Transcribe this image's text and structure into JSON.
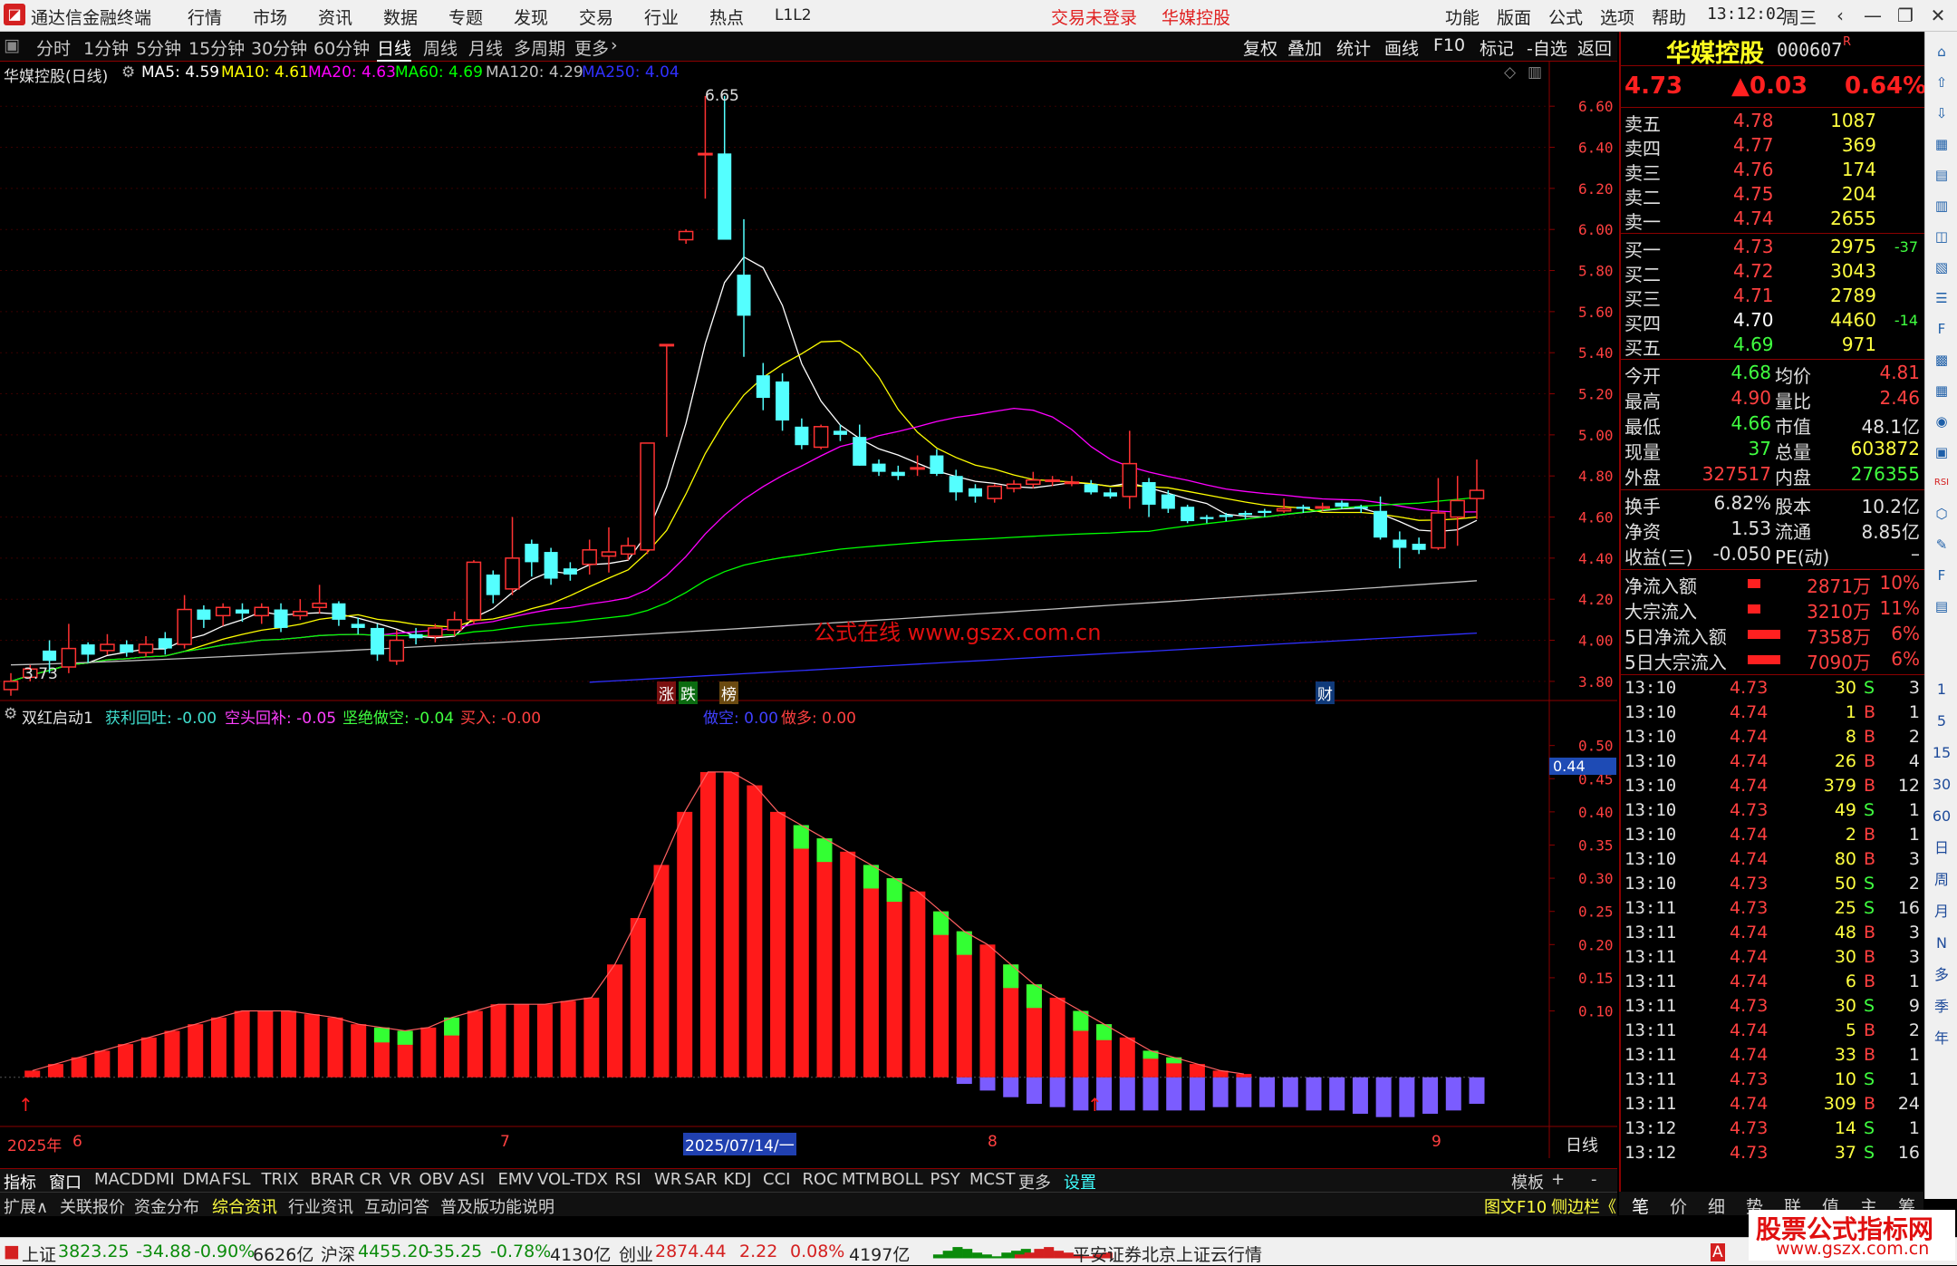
{
  "title_bar": {
    "app_title": "通达信金融终端",
    "menu": [
      "行情",
      "市场",
      "资讯",
      "数据",
      "专题",
      "发现",
      "交易",
      "行业",
      "热点",
      "L1L2"
    ],
    "login_status": "交易未登录",
    "stock_name": "华媒控股",
    "right_menu": [
      "功能",
      "版面",
      "公式",
      "选项",
      "帮助"
    ],
    "time": "13:12:02",
    "weekday": "周三"
  },
  "period_bar": {
    "periods": [
      "分时",
      "1分钟",
      "5分钟",
      "15分钟",
      "30分钟",
      "60分钟",
      "日线",
      "周线",
      "月线",
      "多周期",
      "更多"
    ],
    "active": "日线",
    "tools": [
      "复权",
      "叠加",
      "统计",
      "画线",
      "F10",
      "标记",
      "-自选",
      "返回"
    ]
  },
  "main_chart": {
    "stock_label": "华媒控股(日线)",
    "ma_labels": [
      {
        "text": "MA5: 4.59",
        "color": "#ffffff"
      },
      {
        "text": "MA10: 4.61",
        "color": "#ffff00"
      },
      {
        "text": "MA20: 4.63",
        "color": "#ff00ff"
      },
      {
        "text": "MA60: 4.69",
        "color": "#00ff00"
      },
      {
        "text": "MA120: 4.29",
        "color": "#c0c0c0"
      },
      {
        "text": "MA250: 4.04",
        "color": "#3030ff"
      }
    ],
    "high_label": "6.65",
    "low_label": "3.73",
    "markers": [
      "涨",
      "跌",
      "榜",
      "财"
    ],
    "watermark": "公式在线  www.gszx.com.cn"
  },
  "indicator": {
    "name": "双红启动1",
    "values": [
      {
        "text": "获利回吐: -0.00",
        "color": "#40e0d0"
      },
      {
        "text": "空头回补: -0.05",
        "color": "#ff40ff"
      },
      {
        "text": "坚绝做空: -0.04",
        "color": "#40ff40"
      },
      {
        "text": "买入: -0.00",
        "color": "#ff4040"
      },
      {
        "text": "做空: 0.00",
        "color": "#4040ff"
      },
      {
        "text": "做多: 0.00",
        "color": "#ff4040"
      }
    ],
    "current_value": "0.44"
  },
  "chart_data": [
    {
      "type": "candlestick",
      "title": "华媒控股(日线)",
      "y_ticks": [
        "6.60",
        "6.40",
        "6.20",
        "6.00",
        "5.80",
        "5.60",
        "5.40",
        "5.20",
        "5.00",
        "4.80",
        "4.60",
        "4.40",
        "4.20",
        "4.00",
        "3.80"
      ],
      "ylim": [
        3.72,
        6.72
      ],
      "candles": [
        {
          "o": 3.76,
          "c": 3.8,
          "h": 3.84,
          "l": 3.73
        },
        {
          "o": 3.82,
          "c": 3.86,
          "h": 3.88,
          "l": 3.8
        },
        {
          "o": 3.95,
          "c": 3.9,
          "h": 4.0,
          "l": 3.84
        },
        {
          "o": 3.87,
          "c": 3.96,
          "h": 4.08,
          "l": 3.84
        },
        {
          "o": 3.98,
          "c": 3.93,
          "h": 3.99,
          "l": 3.89
        },
        {
          "o": 3.95,
          "c": 3.98,
          "h": 4.03,
          "l": 3.93
        },
        {
          "o": 3.98,
          "c": 3.94,
          "h": 4.0,
          "l": 3.92
        },
        {
          "o": 3.94,
          "c": 3.98,
          "h": 4.02,
          "l": 3.92
        },
        {
          "o": 4.01,
          "c": 3.96,
          "h": 4.04,
          "l": 3.93
        },
        {
          "o": 3.98,
          "c": 4.15,
          "h": 4.22,
          "l": 3.96
        },
        {
          "o": 4.15,
          "c": 4.1,
          "h": 4.17,
          "l": 4.06
        },
        {
          "o": 4.12,
          "c": 4.16,
          "h": 4.18,
          "l": 4.07
        },
        {
          "o": 4.15,
          "c": 4.13,
          "h": 4.18,
          "l": 4.09
        },
        {
          "o": 4.12,
          "c": 4.16,
          "h": 4.18,
          "l": 4.08
        },
        {
          "o": 4.15,
          "c": 4.06,
          "h": 4.18,
          "l": 4.04
        },
        {
          "o": 4.12,
          "c": 4.14,
          "h": 4.2,
          "l": 4.1
        },
        {
          "o": 4.16,
          "c": 4.18,
          "h": 4.27,
          "l": 4.13
        },
        {
          "o": 4.18,
          "c": 4.1,
          "h": 4.19,
          "l": 4.07
        },
        {
          "o": 4.08,
          "c": 4.06,
          "h": 4.11,
          "l": 4.03
        },
        {
          "o": 4.06,
          "c": 3.93,
          "h": 4.08,
          "l": 3.9
        },
        {
          "o": 3.9,
          "c": 4.0,
          "h": 4.05,
          "l": 3.88
        },
        {
          "o": 4.03,
          "c": 4.01,
          "h": 4.06,
          "l": 3.98
        },
        {
          "o": 4.02,
          "c": 4.06,
          "h": 4.08,
          "l": 3.99
        },
        {
          "o": 4.05,
          "c": 4.1,
          "h": 4.14,
          "l": 4.02
        },
        {
          "o": 4.1,
          "c": 4.38,
          "h": 4.39,
          "l": 4.08
        },
        {
          "o": 4.32,
          "c": 4.22,
          "h": 4.34,
          "l": 4.18
        },
        {
          "o": 4.25,
          "c": 4.4,
          "h": 4.6,
          "l": 4.22
        },
        {
          "o": 4.47,
          "c": 4.38,
          "h": 4.49,
          "l": 4.31
        },
        {
          "o": 4.43,
          "c": 4.3,
          "h": 4.45,
          "l": 4.27
        },
        {
          "o": 4.35,
          "c": 4.32,
          "h": 4.38,
          "l": 4.29
        },
        {
          "o": 4.37,
          "c": 4.44,
          "h": 4.49,
          "l": 4.32
        },
        {
          "o": 4.41,
          "c": 4.43,
          "h": 4.55,
          "l": 4.33
        },
        {
          "o": 4.42,
          "c": 4.46,
          "h": 4.5,
          "l": 4.39
        },
        {
          "o": 4.44,
          "c": 4.96,
          "h": 4.96,
          "l": 4.42
        },
        {
          "o": 5.44,
          "c": 5.44,
          "h": 5.44,
          "l": 4.99
        },
        {
          "o": 5.95,
          "c": 5.99,
          "h": 6.0,
          "l": 5.93
        },
        {
          "o": 6.37,
          "c": 6.37,
          "h": 6.65,
          "l": 6.15
        },
        {
          "o": 6.37,
          "c": 5.95,
          "h": 6.65,
          "l": 5.95
        },
        {
          "o": 5.78,
          "c": 5.58,
          "h": 6.05,
          "l": 5.38
        },
        {
          "o": 5.29,
          "c": 5.18,
          "h": 5.35,
          "l": 5.12
        },
        {
          "o": 5.26,
          "c": 5.07,
          "h": 5.3,
          "l": 5.02
        },
        {
          "o": 5.04,
          "c": 4.95,
          "h": 5.08,
          "l": 4.93
        },
        {
          "o": 4.94,
          "c": 5.04,
          "h": 5.05,
          "l": 4.93
        },
        {
          "o": 5.02,
          "c": 5.0,
          "h": 5.05,
          "l": 4.97
        },
        {
          "o": 4.99,
          "c": 4.85,
          "h": 5.05,
          "l": 4.85
        },
        {
          "o": 4.86,
          "c": 4.82,
          "h": 4.88,
          "l": 4.8
        },
        {
          "o": 4.82,
          "c": 4.8,
          "h": 4.85,
          "l": 4.78
        },
        {
          "o": 4.84,
          "c": 4.84,
          "h": 4.9,
          "l": 4.8
        },
        {
          "o": 4.9,
          "c": 4.81,
          "h": 4.93,
          "l": 4.8
        },
        {
          "o": 4.8,
          "c": 4.72,
          "h": 4.83,
          "l": 4.68
        },
        {
          "o": 4.74,
          "c": 4.7,
          "h": 4.76,
          "l": 4.67
        },
        {
          "o": 4.69,
          "c": 4.75,
          "h": 4.76,
          "l": 4.67
        },
        {
          "o": 4.74,
          "c": 4.76,
          "h": 4.78,
          "l": 4.72
        },
        {
          "o": 4.76,
          "c": 4.78,
          "h": 4.82,
          "l": 4.74
        },
        {
          "o": 4.78,
          "c": 4.78,
          "h": 4.8,
          "l": 4.75
        },
        {
          "o": 4.77,
          "c": 4.77,
          "h": 4.8,
          "l": 4.75
        },
        {
          "o": 4.76,
          "c": 4.72,
          "h": 4.78,
          "l": 4.71
        },
        {
          "o": 4.72,
          "c": 4.7,
          "h": 4.74,
          "l": 4.69
        },
        {
          "o": 4.7,
          "c": 4.86,
          "h": 5.02,
          "l": 4.64
        },
        {
          "o": 4.77,
          "c": 4.66,
          "h": 4.79,
          "l": 4.6
        },
        {
          "o": 4.71,
          "c": 4.64,
          "h": 4.73,
          "l": 4.62
        },
        {
          "o": 4.65,
          "c": 4.58,
          "h": 4.66,
          "l": 4.57
        },
        {
          "o": 4.6,
          "c": 4.59,
          "h": 4.61,
          "l": 4.57
        },
        {
          "o": 4.61,
          "c": 4.6,
          "h": 4.62,
          "l": 4.58
        },
        {
          "o": 4.62,
          "c": 4.61,
          "h": 4.63,
          "l": 4.59
        },
        {
          "o": 4.63,
          "c": 4.62,
          "h": 4.64,
          "l": 4.6
        },
        {
          "o": 4.63,
          "c": 4.64,
          "h": 4.69,
          "l": 4.62
        },
        {
          "o": 4.65,
          "c": 4.64,
          "h": 4.66,
          "l": 4.62
        },
        {
          "o": 4.65,
          "c": 4.65,
          "h": 4.67,
          "l": 4.63
        },
        {
          "o": 4.67,
          "c": 4.65,
          "h": 4.68,
          "l": 4.64
        },
        {
          "o": 4.65,
          "c": 4.64,
          "h": 4.66,
          "l": 4.62
        },
        {
          "o": 4.63,
          "c": 4.5,
          "h": 4.7,
          "l": 4.49
        },
        {
          "o": 4.49,
          "c": 4.45,
          "h": 4.53,
          "l": 4.35
        },
        {
          "o": 4.47,
          "c": 4.44,
          "h": 4.5,
          "l": 4.42
        },
        {
          "o": 4.45,
          "c": 4.62,
          "h": 4.79,
          "l": 4.44
        },
        {
          "o": 4.6,
          "c": 4.68,
          "h": 4.8,
          "l": 4.46
        },
        {
          "o": 4.69,
          "c": 4.73,
          "h": 4.88,
          "l": 4.59
        }
      ]
    },
    {
      "type": "bar",
      "title": "双红启动1",
      "y_ticks": [
        "0.50",
        "0.45",
        "0.40",
        "0.35",
        "0.30",
        "0.25",
        "0.20",
        "0.15",
        "0.10"
      ],
      "ylim": [
        -0.07,
        0.52
      ],
      "values": [
        0.0,
        0.01,
        0.015,
        0.02,
        0.025,
        0.035,
        0.04,
        0.05,
        0.06,
        0.07,
        0.08,
        0.085,
        0.09,
        0.09,
        0.09,
        0.09,
        0.09,
        0.085,
        0.08,
        0.07,
        0.065,
        0.065,
        0.07,
        0.08,
        0.09,
        0.1,
        0.11,
        0.12,
        0.125,
        0.13,
        0.125,
        0.115,
        0.105,
        0.09,
        0.08,
        0.06,
        0.05,
        0.035,
        0.025,
        0.015,
        0.005,
        -0.01,
        -0.02,
        -0.03,
        -0.04,
        -0.045,
        -0.05,
        -0.05,
        -0.05,
        -0.05,
        -0.05,
        -0.05,
        -0.045,
        -0.045,
        -0.045,
        -0.045,
        -0.05,
        -0.05,
        -0.055,
        -0.06,
        -0.06,
        -0.055,
        -0.05,
        -0.04
      ],
      "red_values": [
        0.0,
        0.01,
        0.02,
        0.03,
        0.04,
        0.05,
        0.06,
        0.07,
        0.08,
        0.09,
        0.1,
        0.1,
        0.1,
        0.095,
        0.09,
        0.08,
        0.075,
        0.07,
        0.075,
        0.09,
        0.1,
        0.11,
        0.11,
        0.11,
        0.115,
        0.12,
        0.17,
        0.24,
        0.32,
        0.4,
        0.46,
        0.46,
        0.44,
        0.4,
        0.38,
        0.36,
        0.34,
        0.32,
        0.3,
        0.28,
        0.25,
        0.22,
        0.2,
        0.17,
        0.14,
        0.12,
        0.1,
        0.08,
        0.06,
        0.04,
        0.03,
        0.02,
        0.01,
        0.005
      ]
    }
  ],
  "time_axis": {
    "labels": [
      "2025年",
      "6",
      "7",
      "2025/07/14/一",
      "8",
      "9"
    ],
    "period": "日线"
  },
  "indicator_tabs": [
    "指标",
    "窗口",
    "MACD",
    "DMI",
    "DMA",
    "FSL",
    "TRIX",
    "BRAR",
    "CR",
    "VR",
    "OBV",
    "ASI",
    "EMV",
    "VOL-TDX",
    "RSI",
    "WR",
    "SAR",
    "KDJ",
    "CCI",
    "ROC",
    "MTM",
    "BOLL",
    "PSY",
    "MCST",
    "更多",
    "设置"
  ],
  "template_tabs": [
    "模板",
    "+",
    "-"
  ],
  "bottom_tabs": [
    "扩展∧",
    "关联报价",
    "资金分布",
    "综合资讯",
    "行业资讯",
    "互动问答",
    "普及版功能说明"
  ],
  "bottom_right_tabs": [
    "图文F10",
    "侧边栏《"
  ],
  "quote": {
    "name": "华媒控股",
    "code": "000607",
    "code_mark": "R",
    "price": "4.73",
    "change": "▲0.03",
    "pct": "0.64%",
    "asks": [
      {
        "label": "卖五",
        "price": "4.78",
        "vol": "1087",
        "chg": ""
      },
      {
        "label": "卖四",
        "price": "4.77",
        "vol": "369",
        "chg": ""
      },
      {
        "label": "卖三",
        "price": "4.76",
        "vol": "174",
        "chg": ""
      },
      {
        "label": "卖二",
        "price": "4.75",
        "vol": "204",
        "chg": ""
      },
      {
        "label": "卖一",
        "price": "4.74",
        "vol": "2655",
        "chg": ""
      }
    ],
    "bids": [
      {
        "label": "买一",
        "price": "4.73",
        "vol": "2975",
        "chg": "-37"
      },
      {
        "label": "买二",
        "price": "4.72",
        "vol": "3043",
        "chg": ""
      },
      {
        "label": "买三",
        "price": "4.71",
        "vol": "2789",
        "chg": ""
      },
      {
        "label": "买四",
        "price": "4.70",
        "vol": "4460",
        "chg": "-14"
      },
      {
        "label": "买五",
        "price": "4.69",
        "vol": "971",
        "chg": ""
      }
    ],
    "stats": [
      {
        "l1": "今开",
        "v1": "4.68",
        "c1": "#40ff40",
        "l2": "均价",
        "v2": "4.81",
        "c2": "#ff4040"
      },
      {
        "l1": "最高",
        "v1": "4.90",
        "c1": "#ff4040",
        "l2": "量比",
        "v2": "2.46",
        "c2": "#ff4040"
      },
      {
        "l1": "最低",
        "v1": "4.66",
        "c1": "#40ff40",
        "l2": "市值",
        "v2": "48.1亿",
        "c2": "#e0e0e0"
      },
      {
        "l1": "现量",
        "v1": "37",
        "c1": "#40ff40",
        "l2": "总量",
        "v2": "603872",
        "c2": "#ffff40"
      },
      {
        "l1": "外盘",
        "v1": "327517",
        "c1": "#ff4040",
        "l2": "内盘",
        "v2": "276355",
        "c2": "#40ff40"
      }
    ],
    "stats2": [
      {
        "l1": "换手",
        "v1": "6.82%",
        "l2": "股本",
        "v2": "10.2亿"
      },
      {
        "l1": "净资",
        "v1": "1.53",
        "l2": "流通",
        "v2": "8.85亿"
      },
      {
        "l1": "收益(三)",
        "v1": "-0.050",
        "l2": "PE(动)",
        "v2": "–"
      }
    ],
    "flows": [
      {
        "label": "净流入额",
        "value": "2871万",
        "pct": "10%"
      },
      {
        "label": "大宗流入",
        "value": "3210万",
        "pct": "11%"
      },
      {
        "label": "5日净流入额",
        "value": "7358万",
        "pct": "6%"
      },
      {
        "label": "5日大宗流入",
        "value": "7090万",
        "pct": "6%"
      }
    ],
    "ticks": [
      {
        "t": "13:10",
        "p": "4.73",
        "v": "30",
        "bs": "S",
        "n": "3"
      },
      {
        "t": "13:10",
        "p": "4.74",
        "v": "1",
        "bs": "B",
        "n": "1"
      },
      {
        "t": "13:10",
        "p": "4.74",
        "v": "8",
        "bs": "B",
        "n": "2"
      },
      {
        "t": "13:10",
        "p": "4.74",
        "v": "26",
        "bs": "B",
        "n": "4"
      },
      {
        "t": "13:10",
        "p": "4.74",
        "v": "379",
        "bs": "B",
        "n": "12"
      },
      {
        "t": "13:10",
        "p": "4.73",
        "v": "49",
        "bs": "S",
        "n": "1"
      },
      {
        "t": "13:10",
        "p": "4.74",
        "v": "2",
        "bs": "B",
        "n": "1"
      },
      {
        "t": "13:10",
        "p": "4.74",
        "v": "80",
        "bs": "B",
        "n": "3"
      },
      {
        "t": "13:10",
        "p": "4.73",
        "v": "50",
        "bs": "S",
        "n": "2"
      },
      {
        "t": "13:11",
        "p": "4.73",
        "v": "25",
        "bs": "S",
        "n": "16"
      },
      {
        "t": "13:11",
        "p": "4.74",
        "v": "48",
        "bs": "B",
        "n": "3"
      },
      {
        "t": "13:11",
        "p": "4.74",
        "v": "30",
        "bs": "B",
        "n": "3"
      },
      {
        "t": "13:11",
        "p": "4.74",
        "v": "6",
        "bs": "B",
        "n": "1"
      },
      {
        "t": "13:11",
        "p": "4.73",
        "v": "30",
        "bs": "S",
        "n": "9"
      },
      {
        "t": "13:11",
        "p": "4.74",
        "v": "5",
        "bs": "B",
        "n": "2"
      },
      {
        "t": "13:11",
        "p": "4.74",
        "v": "33",
        "bs": "B",
        "n": "1"
      },
      {
        "t": "13:11",
        "p": "4.73",
        "v": "10",
        "bs": "S",
        "n": "1"
      },
      {
        "t": "13:11",
        "p": "4.74",
        "v": "309",
        "bs": "B",
        "n": "24"
      },
      {
        "t": "13:12",
        "p": "4.73",
        "v": "14",
        "bs": "S",
        "n": "1"
      },
      {
        "t": "13:12",
        "p": "4.73",
        "v": "37",
        "bs": "S",
        "n": "16"
      }
    ]
  },
  "right_tabs": [
    "笔",
    "价",
    "细",
    "势",
    "联",
    "值",
    "主",
    "筹"
  ],
  "side_icons": [
    "1",
    "5",
    "15",
    "30",
    "60",
    "日",
    "周",
    "月",
    "N",
    "多",
    "季",
    "年"
  ],
  "status_bar": {
    "sh_name": "上证",
    "sh_val": "3823.25",
    "sh_chg": "-34.88",
    "sh_pct": "-0.90%",
    "sh_amt": "6626亿",
    "sz_name": "沪深",
    "sz_val": "4455.20",
    "sz_chg": "-35.25",
    "sz_pct": "-0.78%",
    "sz_amt": "4130亿",
    "cy_name": "创业",
    "cy_val": "2874.44",
    "cy_chg": "2.22",
    "cy_pct": "0.08%",
    "cy_amt": "4197亿",
    "server": "平安证券北京上证云行情"
  },
  "corner_watermark": {
    "title": "股票公式指标网",
    "url": "www.gszx.com.cn"
  }
}
